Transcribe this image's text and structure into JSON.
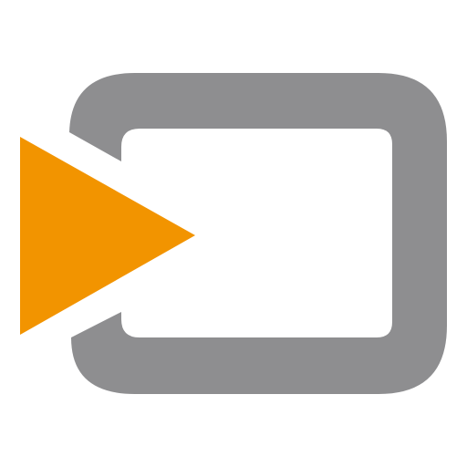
{
  "logo": {
    "icon": "video-play-icon",
    "colors": {
      "frame": "#8e8e90",
      "play": "#f29400",
      "background": "#ffffff"
    }
  }
}
